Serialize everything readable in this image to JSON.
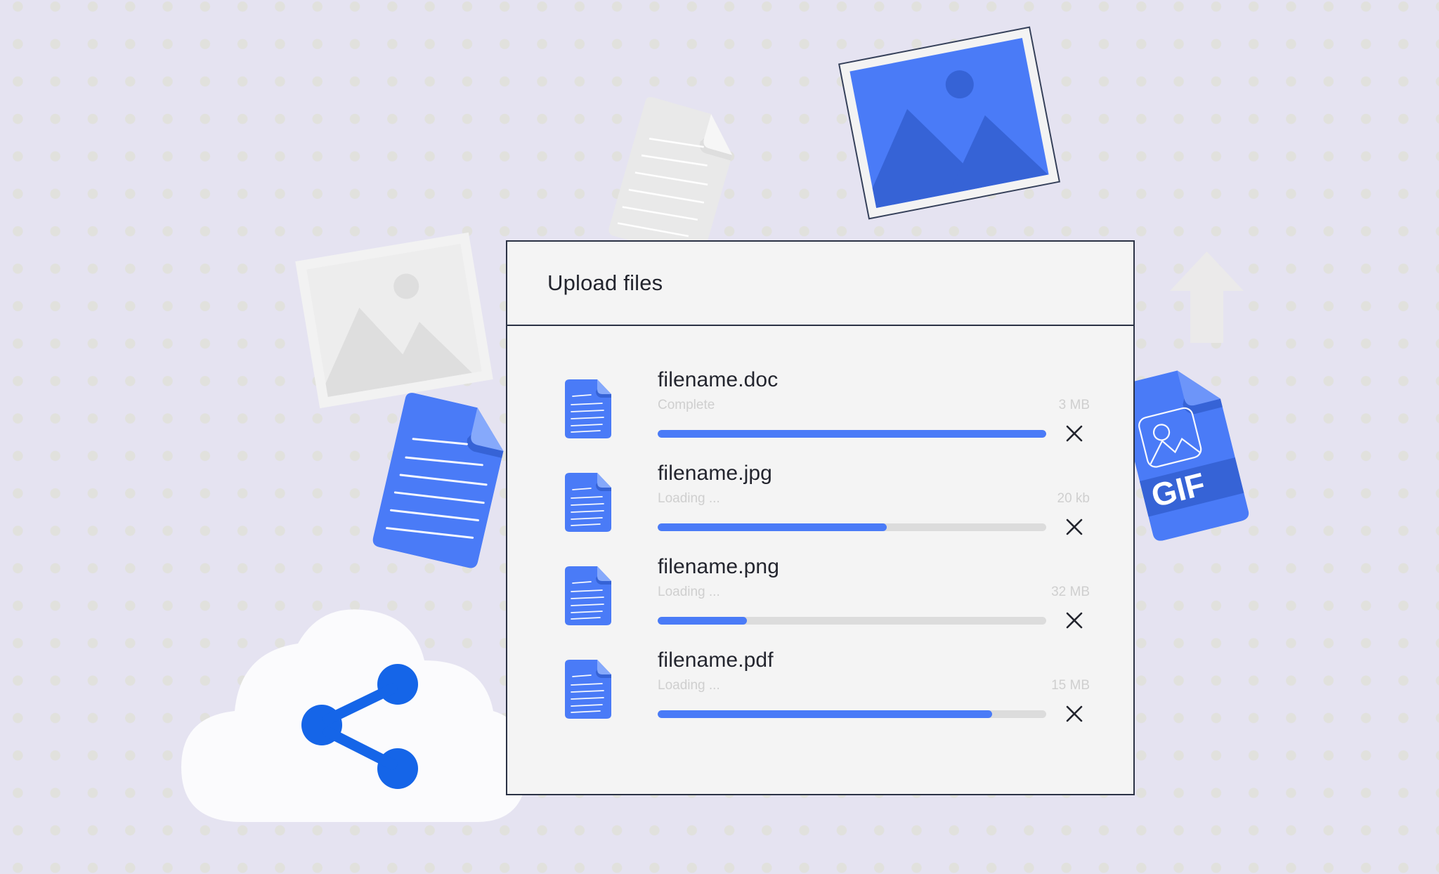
{
  "theme": {
    "background": "#e5e3f1",
    "dot_color": "#e1e1dd",
    "accent": "#4a7bf7",
    "accent_dark": "#3663d6",
    "panel_bg": "#f4f4f4",
    "panel_border": "#2b3245",
    "text_primary": "#23252e",
    "text_muted": "#cfcfcf",
    "track": "#dcdcdc"
  },
  "dialog": {
    "title": "Upload files"
  },
  "files": [
    {
      "name": "filename.doc",
      "status": "Complete",
      "size": "3 MB",
      "progress": 100,
      "icon": "document-icon"
    },
    {
      "name": "filename.jpg",
      "status": "Loading ...",
      "size": "20 kb",
      "progress": 59,
      "icon": "document-icon"
    },
    {
      "name": "filename.png",
      "status": "Loading ...",
      "size": "32 MB",
      "progress": 23,
      "icon": "document-icon"
    },
    {
      "name": "filename.pdf",
      "status": "Loading ...",
      "size": "15 MB",
      "progress": 86,
      "icon": "document-icon"
    }
  ],
  "decorations": {
    "gif_card_label": "GIF",
    "gray_photo": "image-placeholder-icon",
    "blue_photo": "image-photo-icon",
    "gray_paper": "document-page-icon",
    "blue_paper": "document-page-icon",
    "upload_arrow": "arrow-up-icon",
    "cloud_share": "cloud-share-icon"
  }
}
